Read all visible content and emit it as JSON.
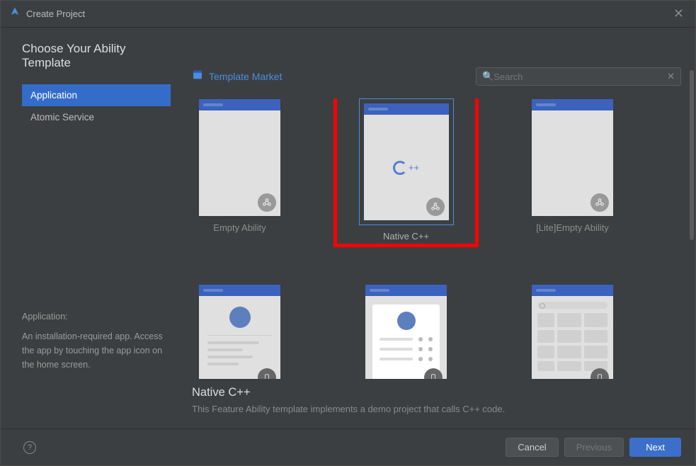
{
  "window": {
    "title": "Create Project"
  },
  "page": {
    "heading": "Choose Your Ability Template"
  },
  "sidebar": {
    "items": [
      {
        "label": "Application",
        "active": true
      },
      {
        "label": "Atomic Service",
        "active": false
      }
    ],
    "desc_title": "Application:",
    "desc_body": "An installation-required app. Access the app by touching the app icon on the home screen."
  },
  "main_header": {
    "market_label": "Template Market"
  },
  "search": {
    "placeholder": "Search"
  },
  "templates": [
    {
      "label": "Empty Ability",
      "kind": "empty"
    },
    {
      "label": "Native C++",
      "kind": "cpp",
      "selected": true,
      "highlighted": true
    },
    {
      "label": "[Lite]Empty Ability",
      "kind": "empty"
    },
    {
      "label": "",
      "kind": "about"
    },
    {
      "label": "",
      "kind": "list"
    },
    {
      "label": "",
      "kind": "grid"
    }
  ],
  "selected": {
    "title": "Native C++",
    "description": "This Feature Ability template implements a demo project that calls C++ code."
  },
  "footer": {
    "cancel": "Cancel",
    "previous": "Previous",
    "next": "Next"
  }
}
